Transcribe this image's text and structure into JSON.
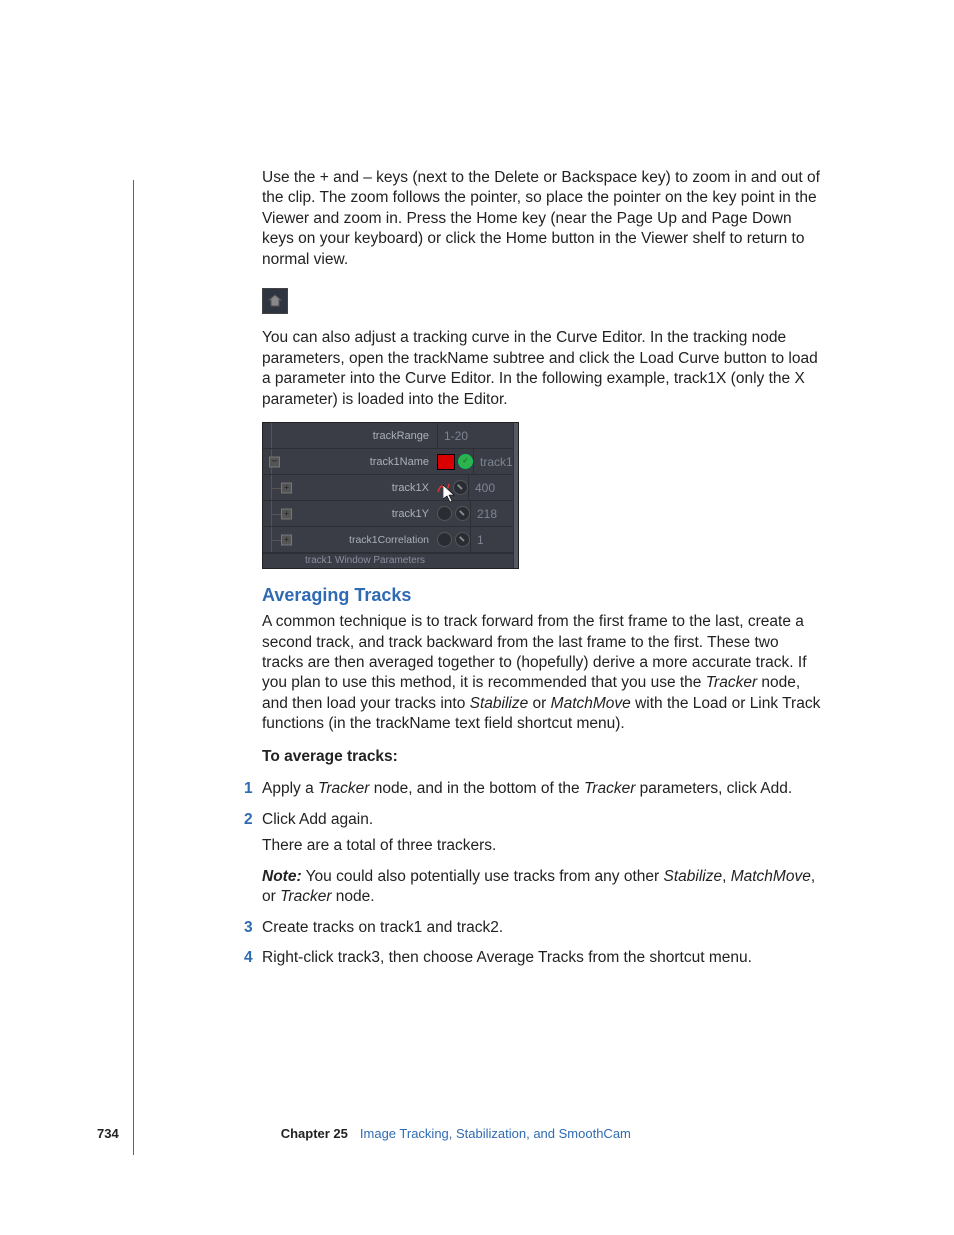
{
  "body": {
    "p1": "Use the + and – keys (next to the Delete or Backspace key) to zoom in and out of the clip. The zoom follows the pointer, so place the pointer on the key point in the Viewer and zoom in. Press the Home key (near the Page Up and Page Down keys on your keyboard) or click the Home button in the Viewer shelf to return to normal view.",
    "p2": "You can also adjust a tracking curve in the Curve Editor. In the tracking node parameters, open the trackName subtree and click the Load Curve button to load a parameter into the Curve Editor. In the following example, track1X (only the X parameter) is loaded into the Editor."
  },
  "panel": {
    "rows": {
      "trackRange": {
        "label": "trackRange",
        "value": "1-20"
      },
      "track1Name": {
        "label": "track1Name",
        "value": "track1"
      },
      "track1X": {
        "label": "track1X",
        "value": "400"
      },
      "track1Y": {
        "label": "track1Y",
        "value": "218"
      },
      "track1Corr": {
        "label": "track1Correlation",
        "value": "1"
      }
    },
    "overflow": "track1 Window Parameters"
  },
  "averaging": {
    "heading": "Averaging Tracks",
    "intro_a": "A common technique is to track forward from the first frame to the last, create a second track, and track backward from the last frame to the first. These two tracks are then averaged together to (hopefully) derive a more accurate track. If you plan to use this method, it is recommended that you use the ",
    "tracker_i": "Tracker",
    "intro_b": " node, and then load your tracks into ",
    "stab_i": "Stabilize",
    "intro_c": " or ",
    "mm_i": "MatchMove",
    "intro_d": " with the Load or Link Track functions (in the trackName text field shortcut menu).",
    "task_heading": "To average tracks:",
    "step1_a": "Apply a ",
    "step1_b": " node, and in the bottom of the ",
    "step1_c": " parameters, click Add.",
    "step2": "Click Add again.",
    "step2_sub": "There are a total of three trackers.",
    "note_label": "Note:",
    "note_a": "  You could also potentially use tracks from any other ",
    "note_stab": "Stabilize",
    "note_sep": ", ",
    "note_mm": "MatchMove",
    "note_b": ", or ",
    "note_tracker": "Tracker",
    "note_c": " node.",
    "step3": "Create tracks on track1 and track2.",
    "step4": "Right-click track3, then choose Average Tracks from the shortcut menu."
  },
  "footer": {
    "page": "734",
    "chapter_label": "Chapter 25",
    "chapter_title": "Image Tracking, Stabilization, and SmoothCam"
  }
}
